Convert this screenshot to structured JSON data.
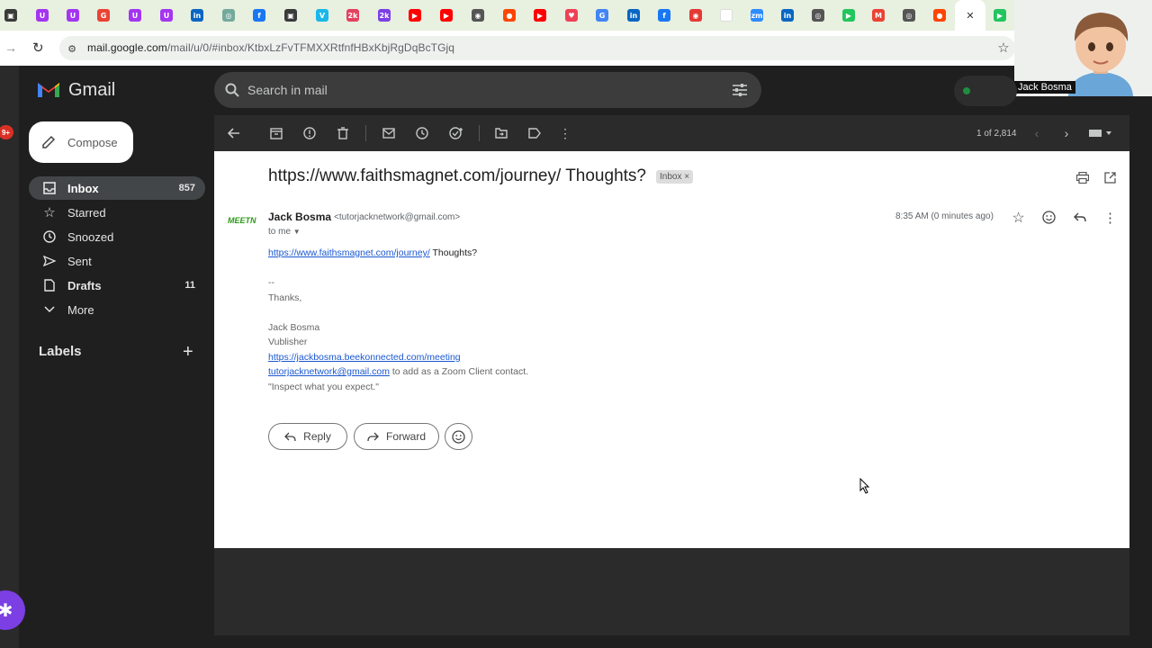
{
  "browser": {
    "tabs": [
      {
        "icon": "mask-icon",
        "color": "#3a3a3a",
        "glyph": "▣"
      },
      {
        "icon": "udemy-icon",
        "color": "#a435f0",
        "glyph": "U"
      },
      {
        "icon": "udemy-icon",
        "color": "#a435f0",
        "glyph": "U"
      },
      {
        "icon": "google-icon",
        "color": "#ea4335",
        "glyph": "G"
      },
      {
        "icon": "udemy-icon",
        "color": "#a435f0",
        "glyph": "U"
      },
      {
        "icon": "udemy-icon",
        "color": "#a435f0",
        "glyph": "U"
      },
      {
        "icon": "linkedin-icon",
        "color": "#0a66c2",
        "glyph": "in"
      },
      {
        "icon": "chatgpt-icon",
        "color": "#74aa9c",
        "glyph": "◎"
      },
      {
        "icon": "facebook-icon",
        "color": "#1877f2",
        "glyph": "f"
      },
      {
        "icon": "mask-icon",
        "color": "#3a3a3a",
        "glyph": "▣"
      },
      {
        "icon": "vimeo-icon",
        "color": "#1ab7ea",
        "glyph": "V"
      },
      {
        "icon": "app-icon",
        "color": "#e4405f",
        "glyph": "2k"
      },
      {
        "icon": "app-icon",
        "color": "#7b3fe4",
        "glyph": "2k"
      },
      {
        "icon": "youtube-icon",
        "color": "#ff0000",
        "glyph": "▶"
      },
      {
        "icon": "youtube-icon",
        "color": "#ff0000",
        "glyph": "▶"
      },
      {
        "icon": "app-icon",
        "color": "#555555",
        "glyph": "◉"
      },
      {
        "icon": "reddit-icon",
        "color": "#ff4500",
        "glyph": "●"
      },
      {
        "icon": "youtube-icon",
        "color": "#ff0000",
        "glyph": "▶"
      },
      {
        "icon": "pocket-icon",
        "color": "#ef4056",
        "glyph": "♥"
      },
      {
        "icon": "google-icon",
        "color": "#4285f4",
        "glyph": "G"
      },
      {
        "icon": "linkedin-icon",
        "color": "#0a66c2",
        "glyph": "in"
      },
      {
        "icon": "facebook-icon",
        "color": "#1877f2",
        "glyph": "f"
      },
      {
        "icon": "record-icon",
        "color": "#e53935",
        "glyph": "◉"
      },
      {
        "icon": "blank-icon",
        "color": "#ffffff",
        "glyph": ""
      },
      {
        "icon": "zoom-icon",
        "color": "#2d8cff",
        "glyph": "zm"
      },
      {
        "icon": "linkedin-icon",
        "color": "#0a66c2",
        "glyph": "in"
      },
      {
        "icon": "chrome-icon",
        "color": "#555555",
        "glyph": "◎"
      },
      {
        "icon": "play-icon",
        "color": "#22c55e",
        "glyph": "▶"
      },
      {
        "icon": "gmail-icon",
        "color": "#ea4335",
        "glyph": "M"
      },
      {
        "icon": "chrome-icon",
        "color": "#555555",
        "glyph": "◎"
      },
      {
        "icon": "reddit-icon",
        "color": "#ff4500",
        "glyph": "●"
      },
      {
        "icon": "close-icon",
        "color": "#ffffff",
        "glyph": "✕",
        "active": true
      },
      {
        "icon": "play-icon",
        "color": "#22c55e",
        "glyph": "▶"
      }
    ],
    "url_host": "mail.google.com",
    "url_path": "/mail/u/0/#inbox/KtbxLzFvTFMXXRtfnfHBxKbjRgDqBcTGjq"
  },
  "webcam": {
    "name": "Jack Bosma"
  },
  "gmail": {
    "app_name": "Gmail",
    "search_placeholder": "Search in mail",
    "compose_label": "Compose",
    "nav": [
      {
        "label": "Inbox",
        "count": "857",
        "selected": true,
        "icon": "inbox-icon"
      },
      {
        "label": "Starred",
        "count": "",
        "icon": "star-icon"
      },
      {
        "label": "Snoozed",
        "count": "",
        "icon": "clock-icon"
      },
      {
        "label": "Sent",
        "count": "",
        "icon": "send-icon"
      },
      {
        "label": "Drafts",
        "count": "11",
        "icon": "draft-icon",
        "bold": true
      },
      {
        "label": "More",
        "count": "",
        "icon": "chevron-down-icon"
      }
    ],
    "labels_heading": "Labels",
    "left_badge": "9+",
    "pagination": "1 of 2,814",
    "message": {
      "subject": "https://www.faithsmagnet.com/journey/ Thoughts?",
      "inbox_chip": "Inbox ×",
      "sender_name": "Jack Bosma",
      "sender_email": "<tutorjacknetwork@gmail.com>",
      "to": "to me",
      "time": "8:35 AM (0 minutes ago)",
      "avatar_text": "MEETN",
      "body_link": "https://www.faithsmagnet.com/journey/",
      "body_text": "Thoughts?",
      "sig_dash": "--",
      "thanks": "Thanks,",
      "sig_name": "Jack Bosma",
      "sig_title": "Vublisher",
      "sig_link": "https://jackbosma.beekonnected.com/meeting",
      "sig_email": "tutorjacknetwork@gmail.com",
      "sig_email_suffix": " to add as a Zoom Client contact.",
      "sig_quote": "\"Inspect what you expect.\""
    },
    "reply_label": "Reply",
    "forward_label": "Forward"
  }
}
